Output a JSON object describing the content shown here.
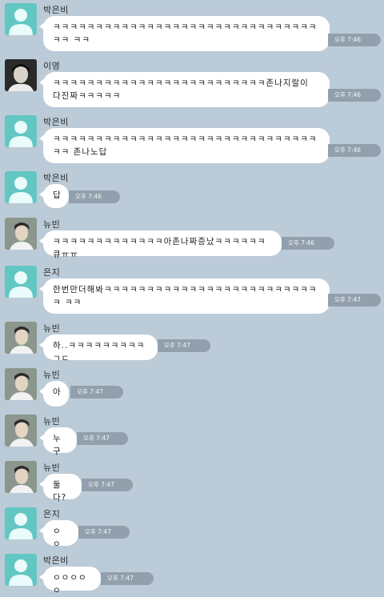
{
  "messages": [
    {
      "sender": "박은비",
      "avatar": "default-profile-icon",
      "text": "ㅋㅋㅋㅋㅋㅋㅋㅋㅋㅋㅋㅋㅋㅋㅋㅋㅋㅋㅋㅋㅋㅋㅋㅋㅋㅋㅋㅋㅋㅋㅋㅋㅋ ㅋㅋ",
      "time": "오후 7:46"
    },
    {
      "sender": "이영",
      "avatar": "user-photo-dark",
      "text": "ㅋㅋㅋㅋㅋㅋㅋㅋㅋㅋㅋㅋㅋㅋㅋㅋㅋㅋㅋㅋㅋㅋㅋㅋㅋ존나지랄이 다진짜ㅋㅋㅋㅋㅋ",
      "time": "오후 7:46"
    },
    {
      "sender": "박은비",
      "avatar": "default-profile-icon",
      "text": "ㅋㅋㅋㅋㅋㅋㅋㅋㅋㅋㅋㅋㅋㅋㅋㅋㅋㅋㅋㅋㅋㅋㅋㅋㅋㅋㅋㅋㅋㅋㅋㅋㅋ 존나노답",
      "time": "오후 7:46"
    },
    {
      "sender": "박은비",
      "avatar": "default-profile-icon",
      "text": "답",
      "time": "오후 7:46"
    },
    {
      "sender": "뉴빈",
      "avatar": "user-photo",
      "text": "ㅋㅋㅋㅋㅋㅋㅋㅋㅋㅋㅋㅋㅋ아존나짜증났ㅋㅋㅋㅋㅋㅋ큐ㅠㅠ",
      "time": "오후 7:46"
    },
    {
      "sender": "은지",
      "avatar": "default-profile-icon",
      "text": "한번만더해봐ㅋㅋㅋㅋㅋㅋㅋㅋㅋㅋㅋㅋㅋㅋㅋㅋㅋㅋㅋㅋㅋㅋㅋㅋㅋㅋ ㅋㅋ",
      "time": "오후 7:47"
    },
    {
      "sender": "뉴빈",
      "avatar": "user-photo",
      "text": "하..ㅋㅋㅋㅋㅋㅋㅋㅋㅋㄱㄷ",
      "time": "오후 7:47"
    },
    {
      "sender": "뉴빈",
      "avatar": "user-photo",
      "text": "아",
      "time": "오후 7:47"
    },
    {
      "sender": "뉴빈",
      "avatar": "user-photo",
      "text": "누구",
      "time": "오후 7:47"
    },
    {
      "sender": "뉴빈",
      "avatar": "user-photo",
      "text": "둘다?",
      "time": "오후 7:47"
    },
    {
      "sender": "은지",
      "avatar": "default-profile-icon",
      "text": "ㅇㅇ",
      "time": "오후 7:47"
    },
    {
      "sender": "박은비",
      "avatar": "default-profile-icon",
      "text": "ㅇㅇㅇㅇㅇ",
      "time": "오후 7:47"
    }
  ],
  "colors": {
    "background": "#bccbd8",
    "bubble": "#ffffff",
    "time_badge": "#92a0ad",
    "default_avatar": "#62c6c3"
  }
}
